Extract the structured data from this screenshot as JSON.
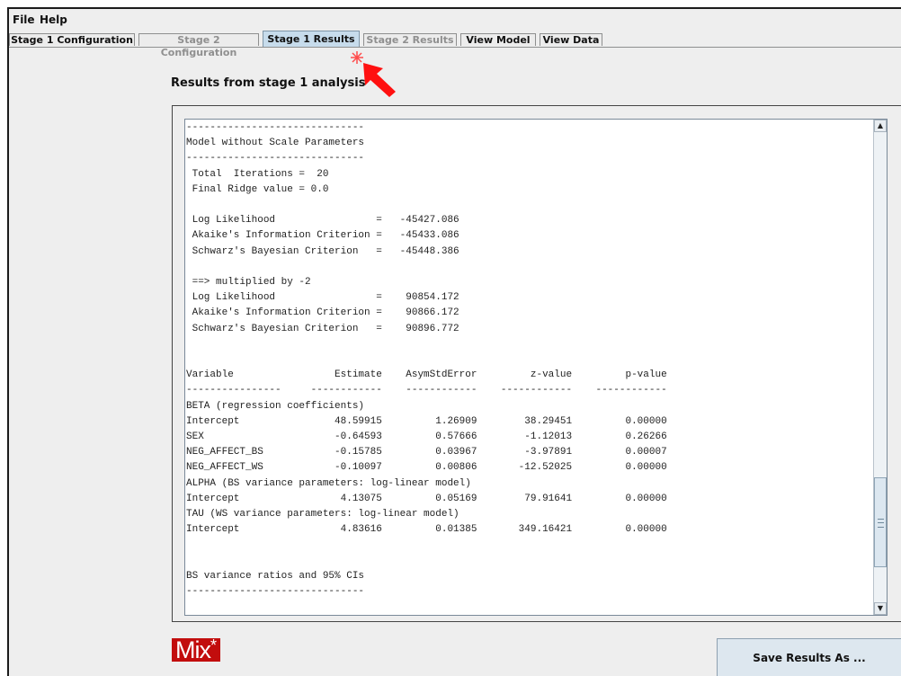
{
  "menu": {
    "file": "File",
    "help": "Help"
  },
  "tabs": [
    {
      "label": "Stage 1 Configuration",
      "state": "enabled"
    },
    {
      "label": "Stage 2 Configuration",
      "state": "disabled"
    },
    {
      "label": "Stage 1 Results",
      "state": "active"
    },
    {
      "label": "Stage 2 Results",
      "state": "disabled"
    },
    {
      "label": "View Model",
      "state": "enabled"
    },
    {
      "label": "View Data",
      "state": "enabled"
    }
  ],
  "results_heading": "Results from stage 1 analysis",
  "output_lines": [
    "------------------------------",
    "Model without Scale Parameters",
    "------------------------------",
    " Total  Iterations =  20",
    " Final Ridge value = 0.0",
    "",
    " Log Likelihood                 =   -45427.086",
    " Akaike's Information Criterion =   -45433.086",
    " Schwarz's Bayesian Criterion   =   -45448.386",
    "",
    " ==> multiplied by -2",
    " Log Likelihood                 =    90854.172",
    " Akaike's Information Criterion =    90866.172",
    " Schwarz's Bayesian Criterion   =    90896.772",
    "",
    "",
    "Variable                 Estimate    AsymStdError         z-value         p-value",
    "----------------     ------------    ------------    ------------    ------------",
    "BETA (regression coefficients)",
    "Intercept                48.59915         1.26909        38.29451         0.00000",
    "SEX                      -0.64593         0.57666        -1.12013         0.26266",
    "NEG_AFFECT_BS            -0.15785         0.03967        -3.97891         0.00007",
    "NEG_AFFECT_WS            -0.10097         0.00806       -12.52025         0.00000",
    "ALPHA (BS variance parameters: log-linear model)",
    "Intercept                 4.13075         0.05169        79.91641         0.00000",
    "TAU (WS variance parameters: log-linear model)",
    "Intercept                 4.83616         0.01385       349.16421         0.00000",
    "",
    "",
    "BS variance ratios and 95% CIs",
    "------------------------------"
  ],
  "logo": {
    "text": "Mix",
    "star": "*"
  },
  "save_button": "Save Results As ...",
  "colors": {
    "active_tab": "#c7dcec",
    "logo_bg": "#c20d0d",
    "arrow": "#ff1010"
  },
  "icons": {
    "scroll_up": "scroll-up-arrow-icon",
    "scroll_down": "scroll-down-arrow-icon",
    "pointer": "red-arrow-icon"
  }
}
